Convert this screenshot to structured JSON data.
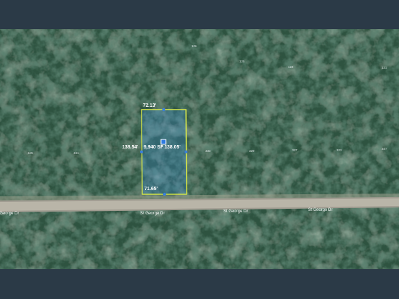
{
  "map": {
    "parcel": {
      "area_label": "9,940 SF",
      "dimensions": {
        "top": "72.13'",
        "left": "138.54'",
        "right": "138.05'",
        "bottom": "71.65'"
      },
      "outline_color": "#d8e84a",
      "fill_color": "#3f8fd4"
    },
    "road": {
      "name_labels": [
        "St George Dr",
        "St George Dr",
        "St George Dr",
        "St George Dr"
      ],
      "color": "#b9b5a8"
    },
    "neighbor_lot_numbers": [
      "126",
      "125",
      "123",
      "121",
      "345",
      "341",
      "333",
      "329",
      "327",
      "323",
      "347"
    ],
    "colors": {
      "background": "#2b3a47",
      "canopy": "#1f3a2a"
    }
  }
}
